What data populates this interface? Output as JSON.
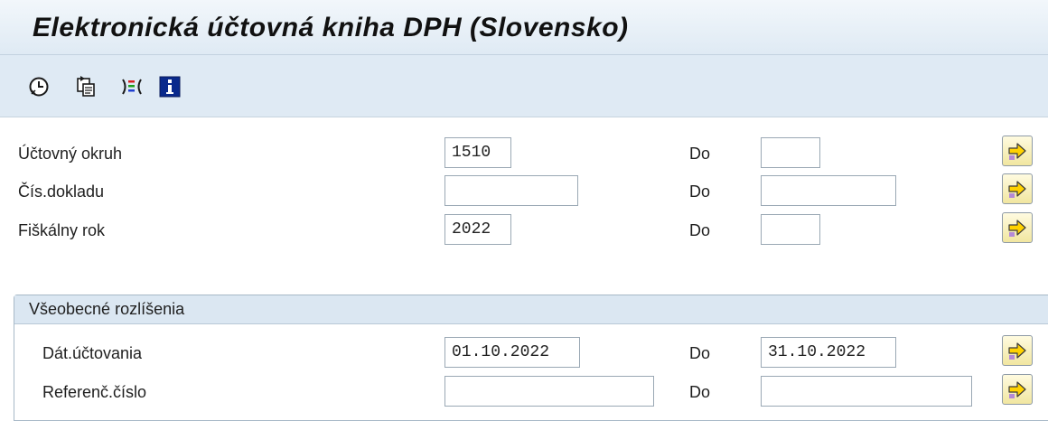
{
  "page": {
    "title": "Elektronická účtovná kniha DPH (Slovensko)"
  },
  "toolbar": {
    "buttons": [
      {
        "name": "execute",
        "icon": "clock-execute-icon"
      },
      {
        "name": "get-variant",
        "icon": "copy-variant-icon"
      },
      {
        "name": "selection-options",
        "icon": "multi-selection-icon"
      },
      {
        "name": "information",
        "icon": "info-icon"
      }
    ]
  },
  "form": {
    "rows": [
      {
        "label": "Účtovný okruh",
        "from_value": "1510",
        "to_label": "Do",
        "to_value": ""
      },
      {
        "label": "Čís.dokladu",
        "from_value": "",
        "to_label": "Do",
        "to_value": ""
      },
      {
        "label": "Fiškálny rok",
        "from_value": "2022",
        "to_label": "Do",
        "to_value": ""
      }
    ]
  },
  "group": {
    "title": "Všeobecné rozlíšenia",
    "rows": [
      {
        "label": "Dát.účtovania",
        "from_value": "01.10.2022",
        "to_label": "Do",
        "to_value": "31.10.2022"
      },
      {
        "label": "Referenč.číslo",
        "from_value": "",
        "to_label": "Do",
        "to_value": ""
      }
    ]
  },
  "colors": {
    "header_bg": "#dfeaf4",
    "arrow_button_bg": "#f7eeb5",
    "arrow_fill": "#ffd200",
    "info_blue": "#0a2a8c"
  }
}
